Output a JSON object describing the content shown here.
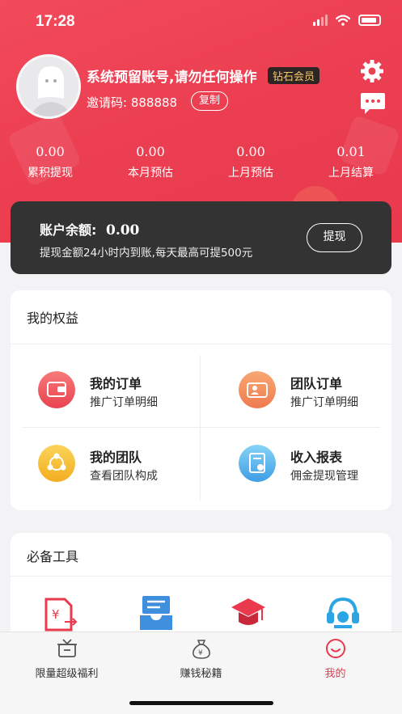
{
  "status_bar": {
    "time": "17:28"
  },
  "profile": {
    "name": "系统预留账号,请勿任何操作",
    "vip_label": "钻石会员",
    "invite_code": "邀请码: 888888",
    "copy_label": "复制"
  },
  "stats": [
    {
      "value": "0.00",
      "label": "累积提现"
    },
    {
      "value": "0.00",
      "label": "本月预估"
    },
    {
      "value": "0.00",
      "label": "上月预估"
    },
    {
      "value": "0.01",
      "label": "上月结算"
    }
  ],
  "balance": {
    "label": "账户余额:",
    "amount": "0.00",
    "description": "提现金额24小时内到账,每天最高可提500元",
    "withdraw_label": "提现"
  },
  "benefits": {
    "title": "我的权益",
    "items": [
      {
        "title": "我的订单",
        "subtitle": "推广订单明细",
        "icon": "wallet-icon"
      },
      {
        "title": "团队订单",
        "subtitle": "推广订单明细",
        "icon": "team-order-icon"
      },
      {
        "title": "我的团队",
        "subtitle": "查看团队构成",
        "icon": "team-icon"
      },
      {
        "title": "收入报表",
        "subtitle": "佣金提现管理",
        "icon": "report-icon"
      }
    ]
  },
  "tools": {
    "title": "必备工具",
    "items": [
      {
        "icon": "income-doc-icon"
      },
      {
        "icon": "inbox-icon"
      },
      {
        "icon": "graduation-cap-icon"
      },
      {
        "icon": "headset-icon"
      }
    ]
  },
  "tabbar": {
    "items": [
      {
        "label": "限量超级福利",
        "icon": "gift-box-icon"
      },
      {
        "label": "赚钱秘籍",
        "icon": "money-bag-icon"
      },
      {
        "label": "我的",
        "icon": "smile-icon"
      }
    ]
  },
  "colors": {
    "brand_red": "#e8394d",
    "dark_card": "#333333",
    "vip_gold": "#f4c86a"
  }
}
